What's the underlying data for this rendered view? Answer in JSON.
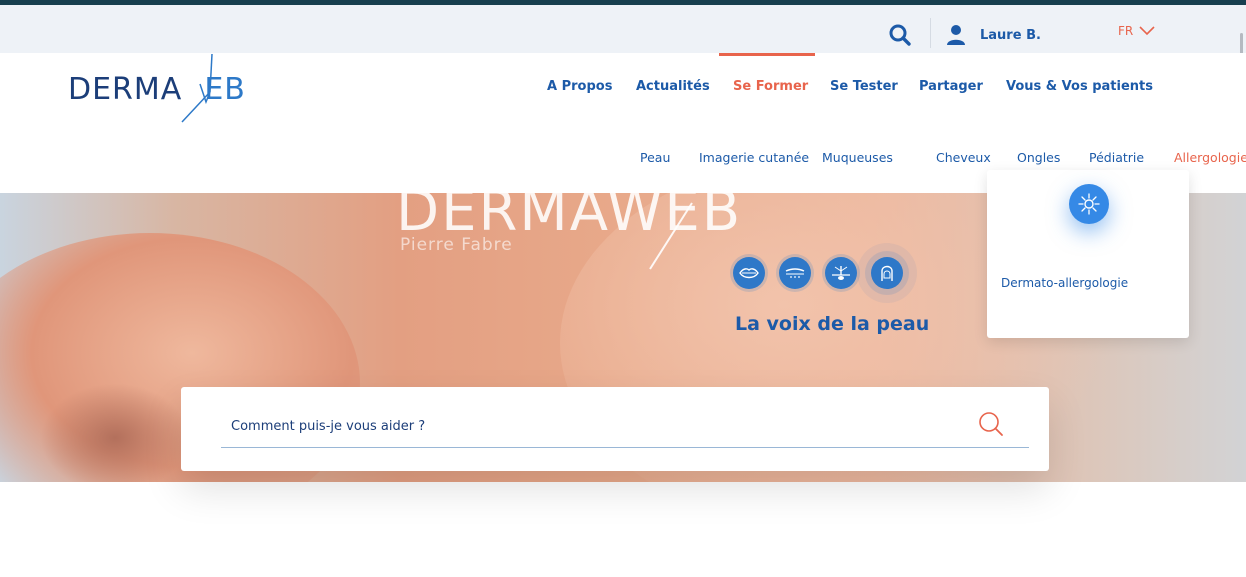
{
  "colors": {
    "brand_dark": "#1c3e79",
    "brand_blue": "#1c5aa8",
    "accent": "#e8644c",
    "top_strip": "#173f4f"
  },
  "header": {
    "user_name": "Laure B.",
    "language": "FR",
    "search_icon": "search-icon",
    "user_icon": "user-icon",
    "lang_icon": "chevron-down-icon"
  },
  "logo": {
    "text_left": "DERMA",
    "text_right": "EB"
  },
  "nav": {
    "items": [
      {
        "label": "A Propos",
        "active": false
      },
      {
        "label": "Actualités",
        "active": false
      },
      {
        "label": "Se Former",
        "active": true
      },
      {
        "label": "Se Tester",
        "active": false
      },
      {
        "label": "Partager",
        "active": false
      },
      {
        "label": "Vous & Vos patients",
        "active": false
      }
    ]
  },
  "subnav": {
    "items": [
      {
        "label": "Peau",
        "active": false
      },
      {
        "label": "Imagerie cutanée",
        "active": false
      },
      {
        "label": "Muqueuses",
        "active": false
      },
      {
        "label": "Cheveux",
        "active": false
      },
      {
        "label": "Ongles",
        "active": false
      },
      {
        "label": "Pédiatrie",
        "active": false
      },
      {
        "label": "Allergologie",
        "active": true
      }
    ]
  },
  "hero": {
    "brand": "DERMAWEB",
    "brand_sub": "Pierre Fabre",
    "tagline": "La voix de la peau",
    "icons": [
      "lips-icon",
      "skin-layer-icon",
      "hair-follicle-icon",
      "nail-icon"
    ]
  },
  "search": {
    "placeholder": "Comment puis-je vous aider ?"
  },
  "dropdown": {
    "icon": "allergy-icon",
    "label": "Dermato-allergologie"
  }
}
